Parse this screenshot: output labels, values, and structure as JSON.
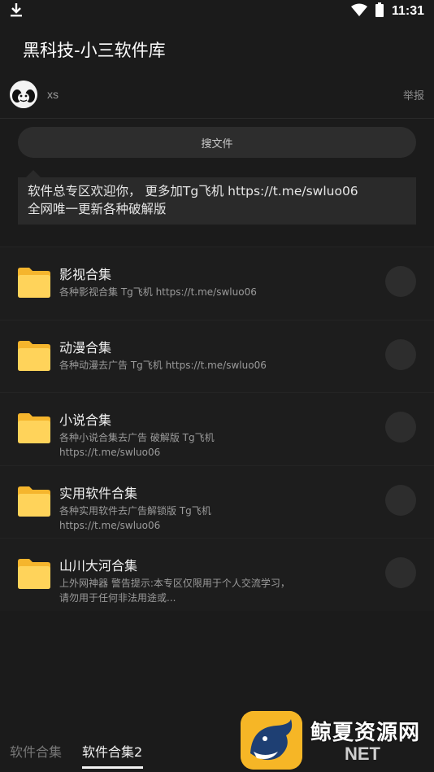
{
  "status_bar": {
    "download_icon": "download-icon",
    "wifi_icon": "wifi-icon",
    "battery_icon": "battery-icon",
    "time": "11:31"
  },
  "app": {
    "title": "黑科技-小三软件库"
  },
  "author": {
    "name": "xs",
    "report_label": "举报"
  },
  "search": {
    "label": "搜文件"
  },
  "announcement": {
    "line1": "软件总专区欢迎你， 更多加Tg飞机 https://t.me/swluo06",
    "line2": "全网唯一更新各种破解版"
  },
  "items": [
    {
      "title": "影视合集",
      "desc": "各种影视合集 Tg飞机 https://t.me/swluo06"
    },
    {
      "title": "动漫合集",
      "desc": "各种动漫去广告 Tg飞机 https://t.me/swluo06"
    },
    {
      "title": "小说合集",
      "desc": "各种小说合集去广告 破解版 Tg飞机 https://t.me/swluo06"
    },
    {
      "title": "实用软件合集",
      "desc": "各种实用软件去广告解锁版 Tg飞机 https://t.me/swluo06"
    },
    {
      "title": "山川大河合集",
      "desc": "上外网神器 警告提示:本专区仅限用于个人交流学习，请勿用于任何非法用途或..."
    }
  ],
  "tabs": [
    {
      "label": "软件合集",
      "active": false
    },
    {
      "label": "软件合集2",
      "active": true
    }
  ],
  "watermark": {
    "text": "鲸夏资源网",
    "sub": "NET"
  },
  "colors": {
    "background": "#1b1b1b",
    "folder": "#ffc93c",
    "watermark_logo": "#f6b626"
  }
}
